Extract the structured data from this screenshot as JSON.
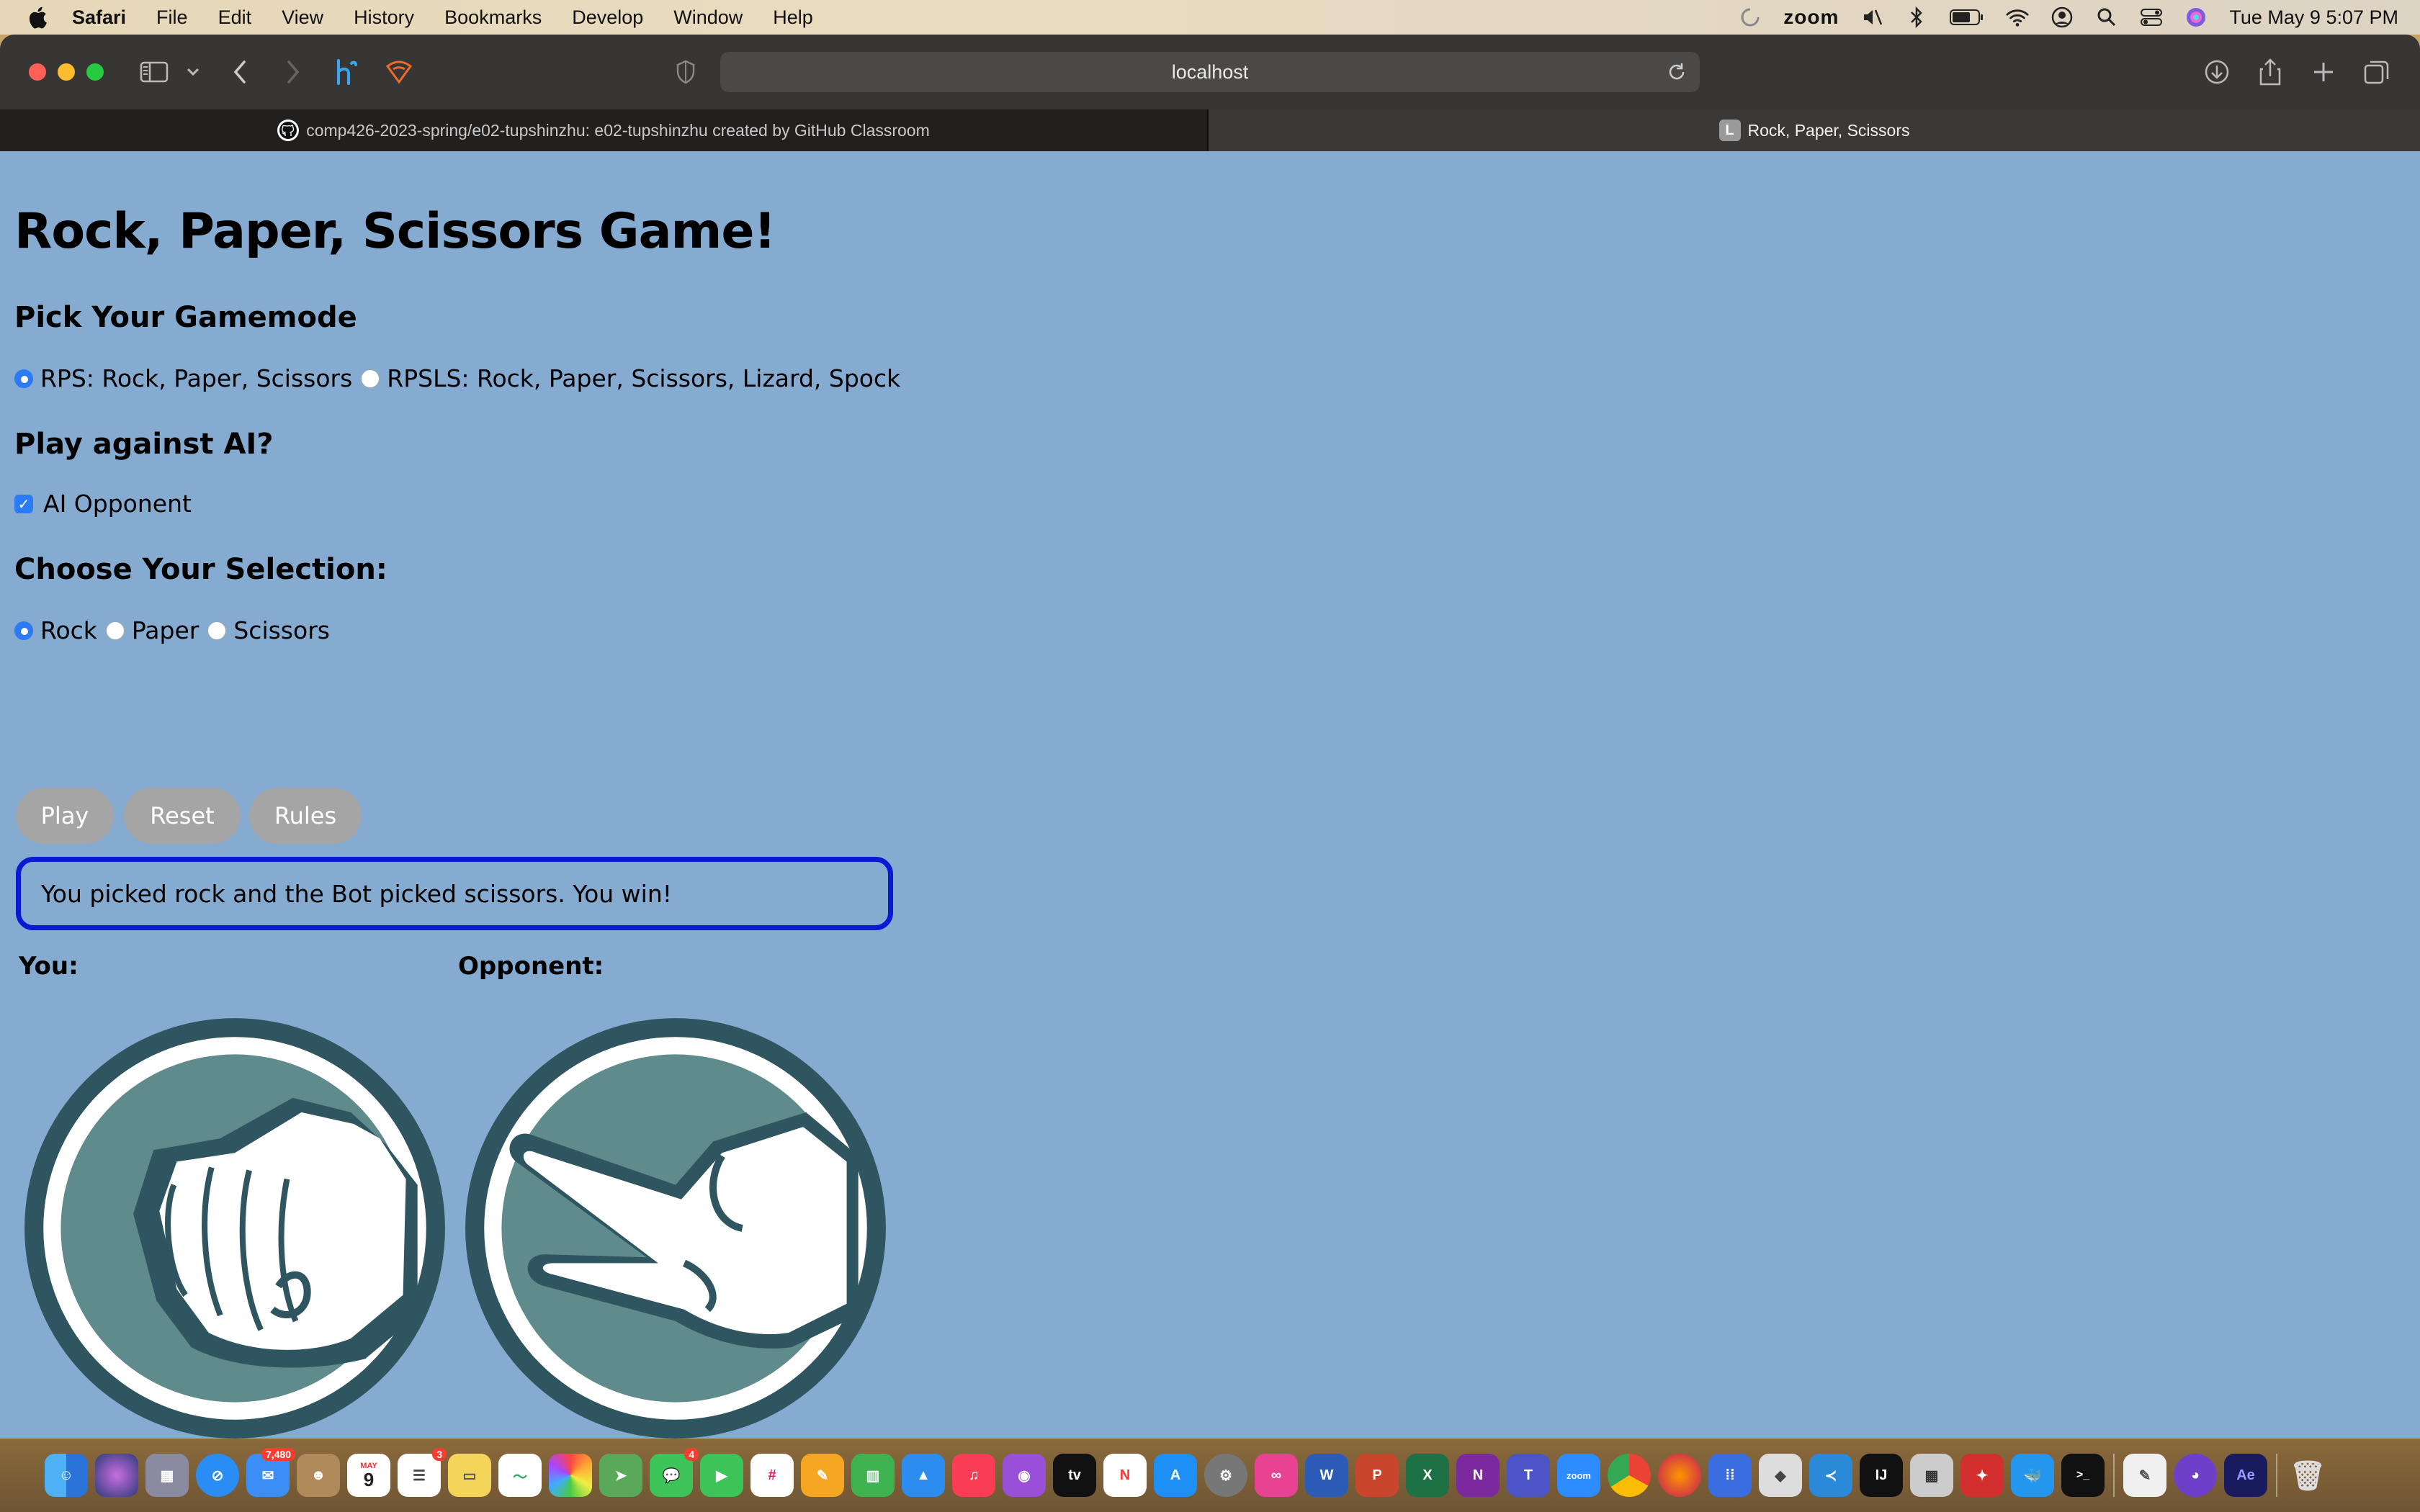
{
  "menubar": {
    "app_name": "Safari",
    "items": [
      "File",
      "Edit",
      "View",
      "History",
      "Bookmarks",
      "Develop",
      "Window",
      "Help"
    ],
    "zoom_label": "zoom",
    "datetime": "Tue May 9  5:07 PM"
  },
  "browser": {
    "url": "localhost",
    "tabs": [
      {
        "label": "comp426-2023-spring/e02-tupshinzhu: e02-tupshinzhu created by GitHub Classroom",
        "favicon": "github-icon"
      },
      {
        "label": "Rock, Paper, Scissors",
        "favicon_letter": "L",
        "active": true
      }
    ]
  },
  "page": {
    "title": "Rock, Paper, Scissors Game!",
    "gamemode": {
      "heading": "Pick Your Gamemode",
      "options": [
        {
          "label": "RPS: Rock, Paper, Scissors",
          "selected": true
        },
        {
          "label": "RPSLS: Rock, Paper, Scissors, Lizard, Spock",
          "selected": false
        }
      ]
    },
    "ai": {
      "heading": "Play against AI?",
      "checkbox_label": "AI Opponent",
      "checked": true
    },
    "selection": {
      "heading": "Choose Your Selection:",
      "options": [
        {
          "label": "Rock",
          "selected": true
        },
        {
          "label": "Paper",
          "selected": false
        },
        {
          "label": "Scissors",
          "selected": false
        }
      ]
    },
    "buttons": {
      "play": "Play",
      "reset": "Reset",
      "rules": "Rules"
    },
    "result_text": "You picked rock and the Bot picked scissors. You win!",
    "players": {
      "you_label": "You:",
      "opponent_label": "Opponent:",
      "you_choice_icon": "rock-hand-icon",
      "opponent_choice_icon": "scissors-hand-icon"
    }
  },
  "dock": {
    "badges": {
      "mail": "7,480",
      "calendar_month": "MAY",
      "calendar_day": "9",
      "reminders": "3",
      "messages": "4"
    },
    "tv_label": "tv",
    "zoom_label": "zoom",
    "intellij_label": "IJ",
    "ae_label": "Ae"
  },
  "colors": {
    "page_bg": "#85abd1",
    "result_border": "#0a1ad4",
    "button_bg": "#a5a5a5",
    "hand_ring": "#2f5560",
    "hand_fill": "#5f8b8c"
  }
}
